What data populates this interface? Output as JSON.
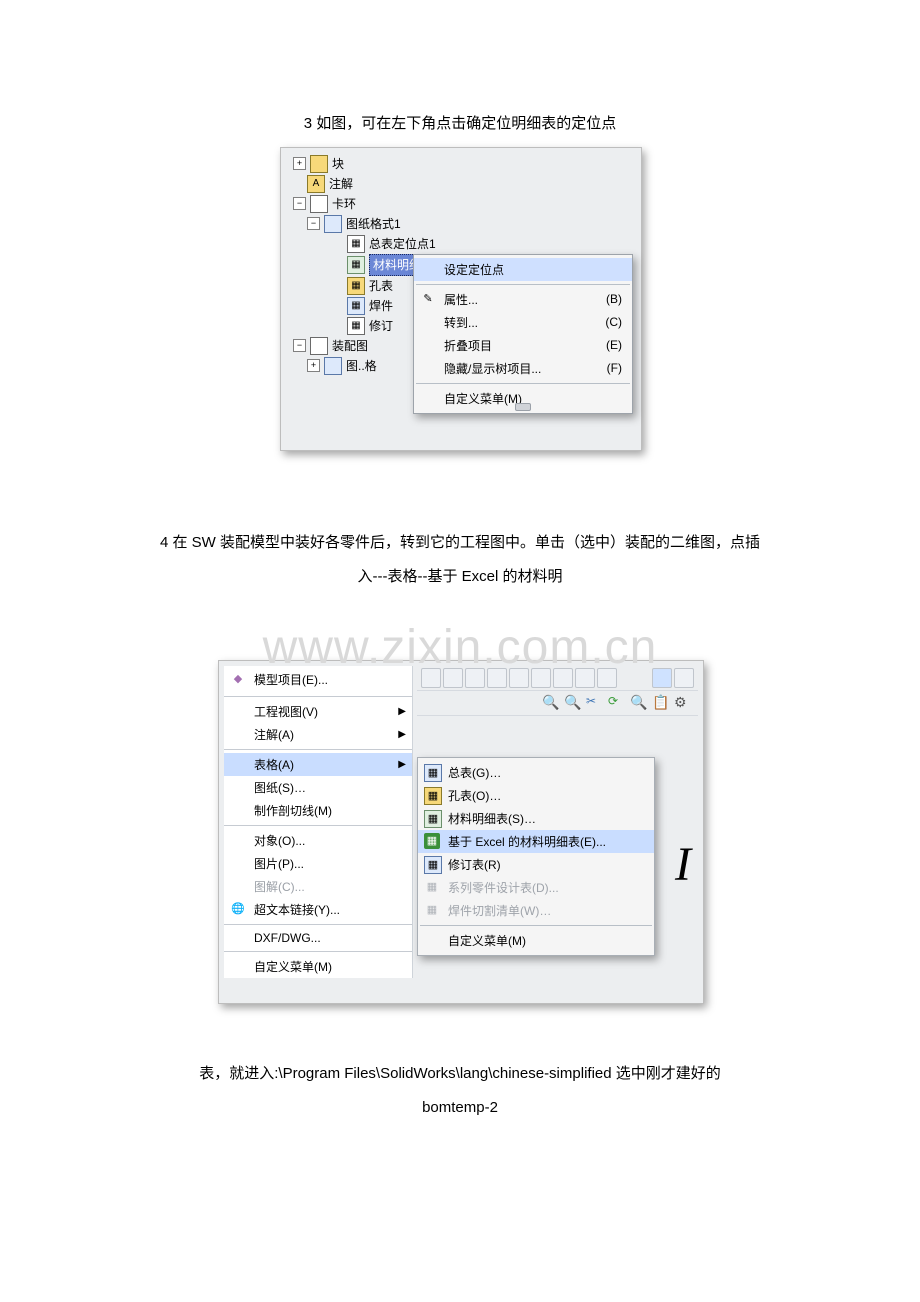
{
  "captions": {
    "c3": "3 如图，可在左下角点击确定位明细表的定位点",
    "c4a": "4 在 SW 装配模型中装好各零件后，转到它的工程图中。单击（选中）装配的二维图，点插",
    "c4b": "入---表格--基于 Excel 的材料明",
    "c5a": "表，就进入:\\Program Files\\SolidWorks\\lang\\chinese-simplified 选中刚才建好的",
    "c5b": "bomtemp-2"
  },
  "watermark": "www.zixin.com.cn",
  "tree": {
    "n0": "块",
    "n1": "注解",
    "n2": "卡环",
    "n3": "图纸格式1",
    "n4": "总表定位点1",
    "n5": "材料明细表定位点",
    "n6": "孔表",
    "n7": "焊件",
    "n8": "修订",
    "n9": "装配图",
    "n10": "图..格"
  },
  "ctx1": {
    "i0": "设定定位点",
    "i1": "属性...",
    "i1s": "(B)",
    "i2": "转到...",
    "i2s": "(C)",
    "i3": "折叠项目",
    "i3s": "(E)",
    "i4": "隐藏/显示树项目...",
    "i4s": "(F)",
    "i5": "自定义菜单(M)"
  },
  "menu2": {
    "m0": "模型项目(E)...",
    "m1": "工程视图(V)",
    "m2": "注解(A)",
    "m3": "表格(A)",
    "m4": "图纸(S)…",
    "m5": "制作剖切线(M)",
    "m6": "对象(O)...",
    "m7": "图片(P)...",
    "m8": "图解(C)...",
    "m9": "超文本链接(Y)...",
    "m10": "DXF/DWG...",
    "m11": "自定义菜单(M)"
  },
  "submenu2": {
    "s0": "总表(G)…",
    "s1": "孔表(O)…",
    "s2": "材料明细表(S)…",
    "s3": "基于 Excel 的材料明细表(E)...",
    "s4": "修订表(R)",
    "s5": "系列零件设计表(D)...",
    "s6": "焊件切割清单(W)…",
    "s7": "自定义菜单(M)"
  }
}
